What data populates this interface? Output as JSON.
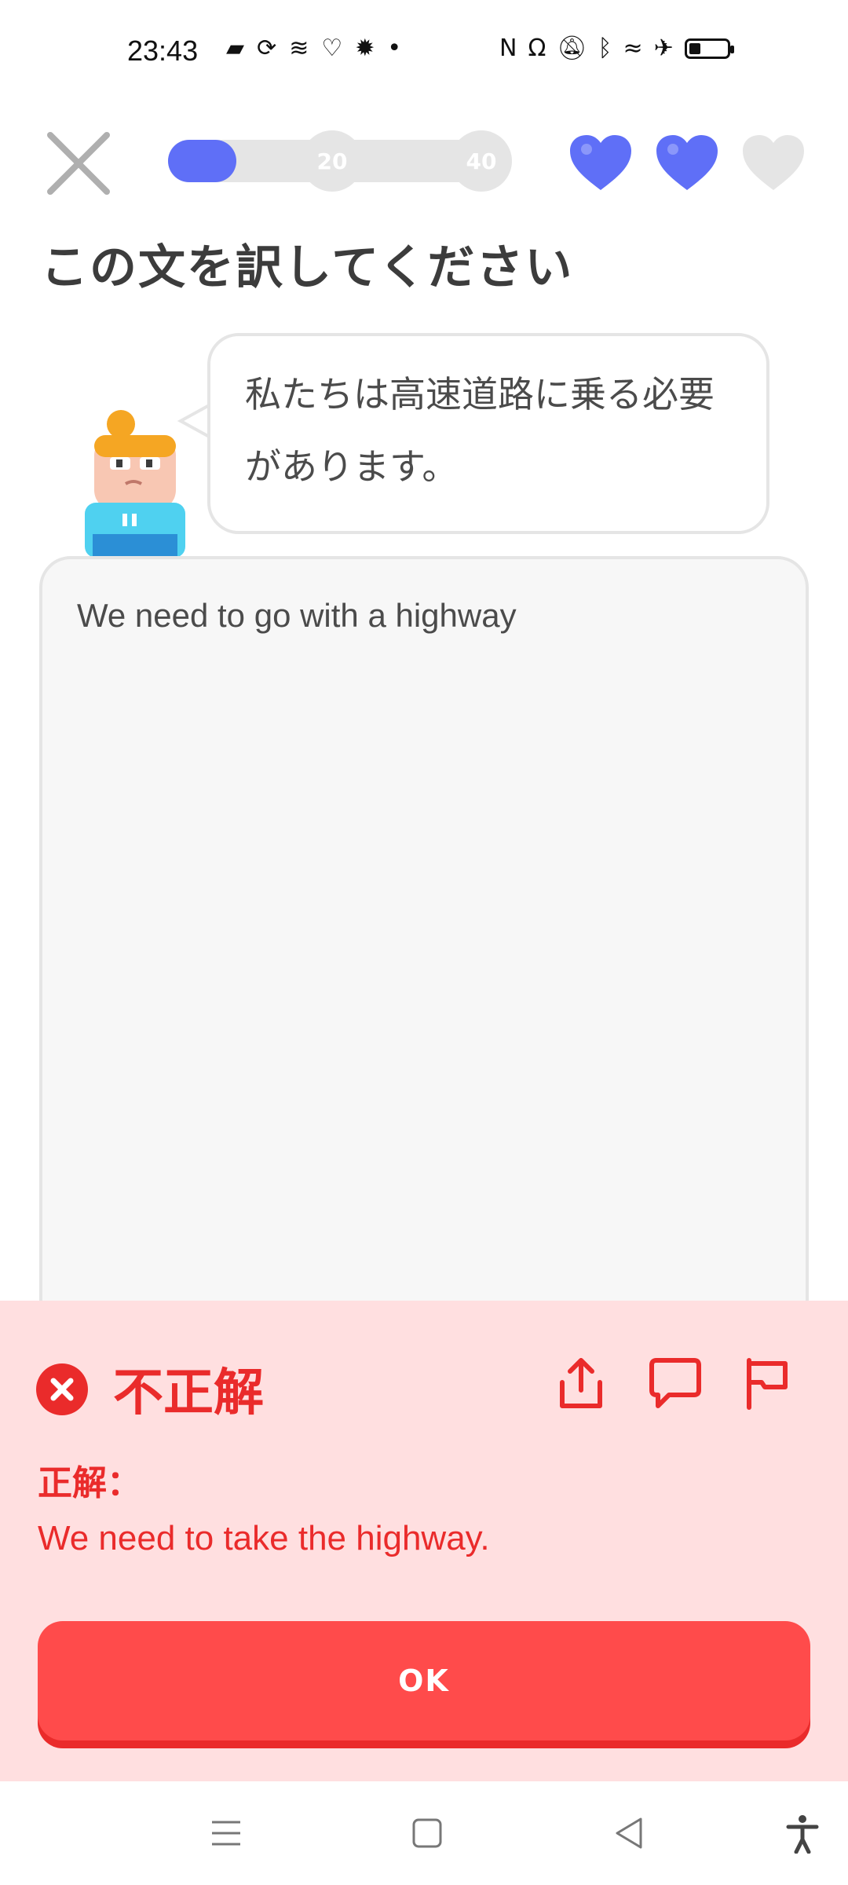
{
  "status_bar": {
    "time": "23:43",
    "battery_level": 0.3,
    "icons_left": [
      "news-icon",
      "sync-icon",
      "activity-icon",
      "heart-outline-icon",
      "gear-bug-icon",
      "dot-icon"
    ],
    "icons_right": [
      "nfc-icon",
      "headphones-icon",
      "mute-icon",
      "bluetooth-icon",
      "wifi-icon",
      "airplane-icon",
      "battery-icon"
    ]
  },
  "header": {
    "progress_fraction": 0.2,
    "milestones": [
      "20",
      "40"
    ],
    "hearts": {
      "filled": 2,
      "total": 3
    }
  },
  "prompt": {
    "title": "この文を訳してください",
    "sentence_line1": "私たちは高速道路に乗る必要",
    "sentence_line2": "があります。"
  },
  "answer": {
    "text": "We need to go with a highway"
  },
  "feedback": {
    "status": "不正解",
    "correct_label": "正解：",
    "correct_answer": "We need to take the highway.",
    "ok_label": "OK",
    "colors": {
      "error": "#ea2b2b",
      "panel": "#ffdfe0",
      "button": "#ff4b4b"
    }
  },
  "colors": {
    "accent": "#5f6ff7",
    "border": "#e5e5e5"
  },
  "nav": [
    "menu-icon",
    "home-icon",
    "back-icon",
    "accessibility-icon"
  ]
}
